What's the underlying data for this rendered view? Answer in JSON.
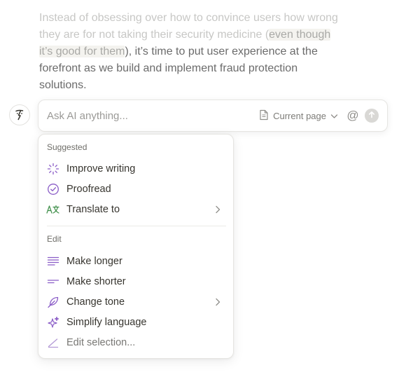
{
  "document": {
    "lines": [
      {
        "text": "Instead of obsessing over how to convince users how wrong",
        "style": "faded"
      },
      {
        "parts": [
          {
            "text": "they are for not taking their security medicine (",
            "style": "faded"
          },
          {
            "text": "even though",
            "style": "hl"
          }
        ]
      },
      {
        "parts": [
          {
            "text": "it’s good for them",
            "style": "hl"
          },
          {
            "text": "), it’s time to put user experience at the",
            "style": "normal"
          }
        ]
      },
      {
        "text": "forefront as we build and implement fraud protection",
        "style": "normal"
      },
      {
        "text": "solutions.",
        "style": "normal"
      }
    ]
  },
  "ask_bar": {
    "placeholder": "Ask AI anything...",
    "value": "",
    "scope_label": "Current page",
    "scope_icon": "page-icon",
    "mention_symbol": "@",
    "send_icon": "arrow-up-icon"
  },
  "menu": {
    "suggested_title": "Suggested",
    "edit_title": "Edit",
    "suggested": [
      {
        "label": "Improve writing",
        "icon": "sparkle-burst-icon",
        "submenu": false
      },
      {
        "label": "Proofread",
        "icon": "check-circle-icon",
        "submenu": false
      },
      {
        "label": "Translate to",
        "icon": "translate-icon",
        "submenu": true
      }
    ],
    "edit": [
      {
        "label": "Make longer",
        "icon": "lines-long-icon",
        "submenu": false
      },
      {
        "label": "Make shorter",
        "icon": "lines-short-icon",
        "submenu": false
      },
      {
        "label": "Change tone",
        "icon": "feather-icon",
        "submenu": true
      },
      {
        "label": "Simplify language",
        "icon": "sparkles-icon",
        "submenu": false
      },
      {
        "label": "Edit selection...",
        "icon": "pencil-line-icon",
        "submenu": false
      }
    ]
  },
  "colors": {
    "accent_purple": "#8a5cc7",
    "translate_green": "#3f8f4a",
    "text": "#37352f",
    "muted": "#9b9a97"
  }
}
